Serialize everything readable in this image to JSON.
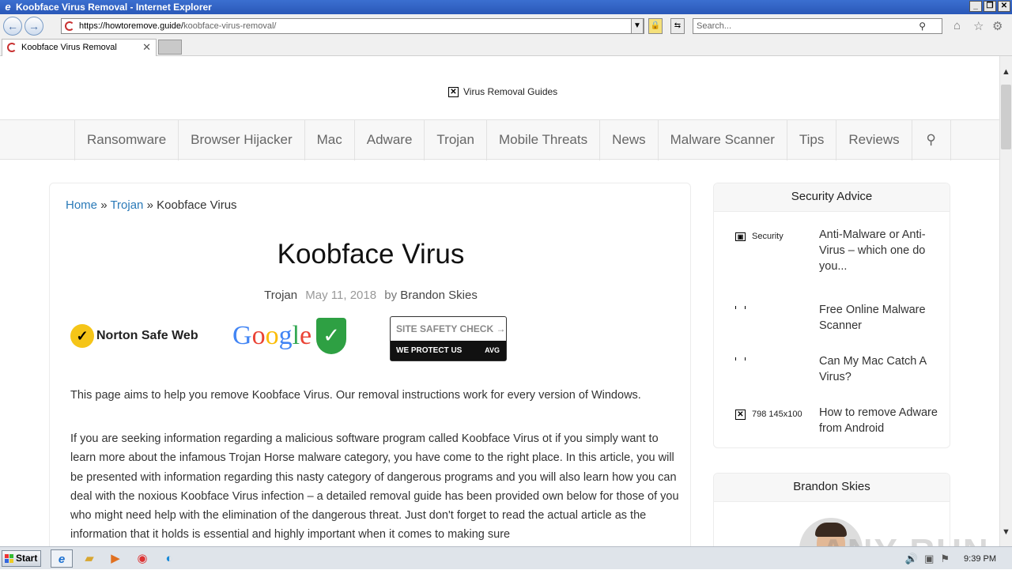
{
  "window": {
    "title": "Koobface Virus Removal - Internet Explorer"
  },
  "addressbar": {
    "url_host": "https://howtoremove.guide/",
    "url_path": "koobface-virus-removal/"
  },
  "searchbox": {
    "placeholder": "Search..."
  },
  "tab": {
    "label": "Koobface Virus Removal"
  },
  "site": {
    "logo_alt": "Virus Removal Guides",
    "menu": [
      "Ransomware",
      "Browser Hijacker",
      "Mac",
      "Adware",
      "Trojan",
      "Mobile Threats",
      "News",
      "Malware Scanner",
      "Tips",
      "Reviews"
    ]
  },
  "article": {
    "breadcrumb": {
      "home": "Home",
      "sep1": "»",
      "cat": "Trojan",
      "sep2": "»",
      "current": "Koobface Virus"
    },
    "title": "Koobface Virus",
    "meta": {
      "category": "Trojan",
      "date": "May 11, 2018",
      "by": "by",
      "author": "Brandon Skies"
    },
    "badges": {
      "norton": "Norton Safe Web",
      "google": "Google",
      "avg_top": "SITE SAFETY CHECK",
      "avg_bottom": "WE PROTECT US",
      "avg_brand": "AVG"
    },
    "p1": "This page aims to help you remove Koobface Virus. Our removal instructions work for every version of Windows.",
    "p2": "If you are seeking information regarding a malicious software program called Koobface Virus ot if you simply want to learn more about the infamous Trojan Horse malware category, you have come to the right place. In this article, you will be presented with information regarding this nasty category of dangerous programs and you will also learn how you can deal with the noxious Koobface Virus infection – a detailed removal guide has been provided own below for those of you who might need help with the elimination of the dangerous threat. Just don't forget to read the actual article as the information that it holds is essential and highly important when it comes to making sure"
  },
  "sidebar": {
    "security_title": "Security Advice",
    "items": [
      {
        "thumb_alt": "Security",
        "link": "Anti-Malware or Anti-Virus – which one do you..."
      },
      {
        "thumb_alt": "",
        "link": "Free Online Malware Scanner"
      },
      {
        "thumb_alt": "",
        "link": "Can My Mac Catch A Virus?"
      },
      {
        "thumb_alt": "798 145x100",
        "link": "How to remove Adware from Android"
      }
    ],
    "author_title": "Brandon Skies"
  },
  "watermark": "ANY RUN",
  "taskbar": {
    "start": "Start",
    "clock": "9:39 PM"
  }
}
